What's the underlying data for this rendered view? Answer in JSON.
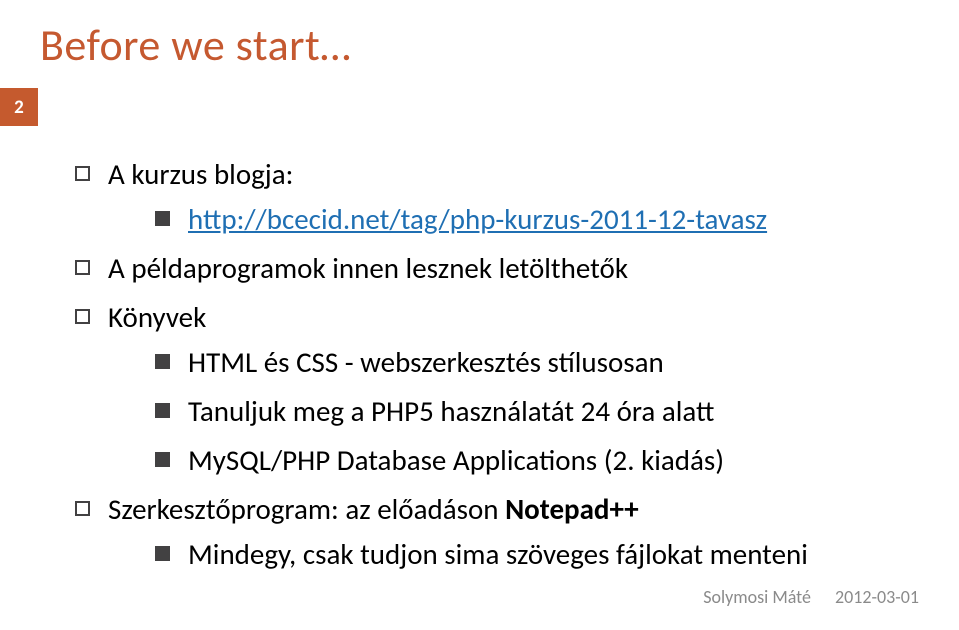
{
  "title": "Before we start…",
  "page_number": "2",
  "items": [
    {
      "text": "A kurzus blogja:",
      "children": [
        {
          "link": "http://bcecid.net/tag/php-kurzus-2011-12-tavasz"
        }
      ]
    },
    {
      "text": "A példaprogramok innen lesznek letölthetők"
    },
    {
      "text": "Könyvek",
      "children": [
        {
          "text": "HTML és CSS - webszerkesztés stílusosan"
        },
        {
          "text": "Tanuljuk meg a PHP5 használatát 24 óra alatt"
        },
        {
          "text": "MySQL/PHP Database Applications (2. kiadás)"
        }
      ]
    },
    {
      "text_prefix": "Szerkesztőprogram: az előadáson ",
      "text_bold": "Notepad++",
      "children": [
        {
          "text": "Mindegy, csak tudjon sima szöveges fájlokat menteni"
        }
      ]
    }
  ],
  "footer": {
    "author": "Solymosi Máté",
    "date": "2012-03-01"
  }
}
